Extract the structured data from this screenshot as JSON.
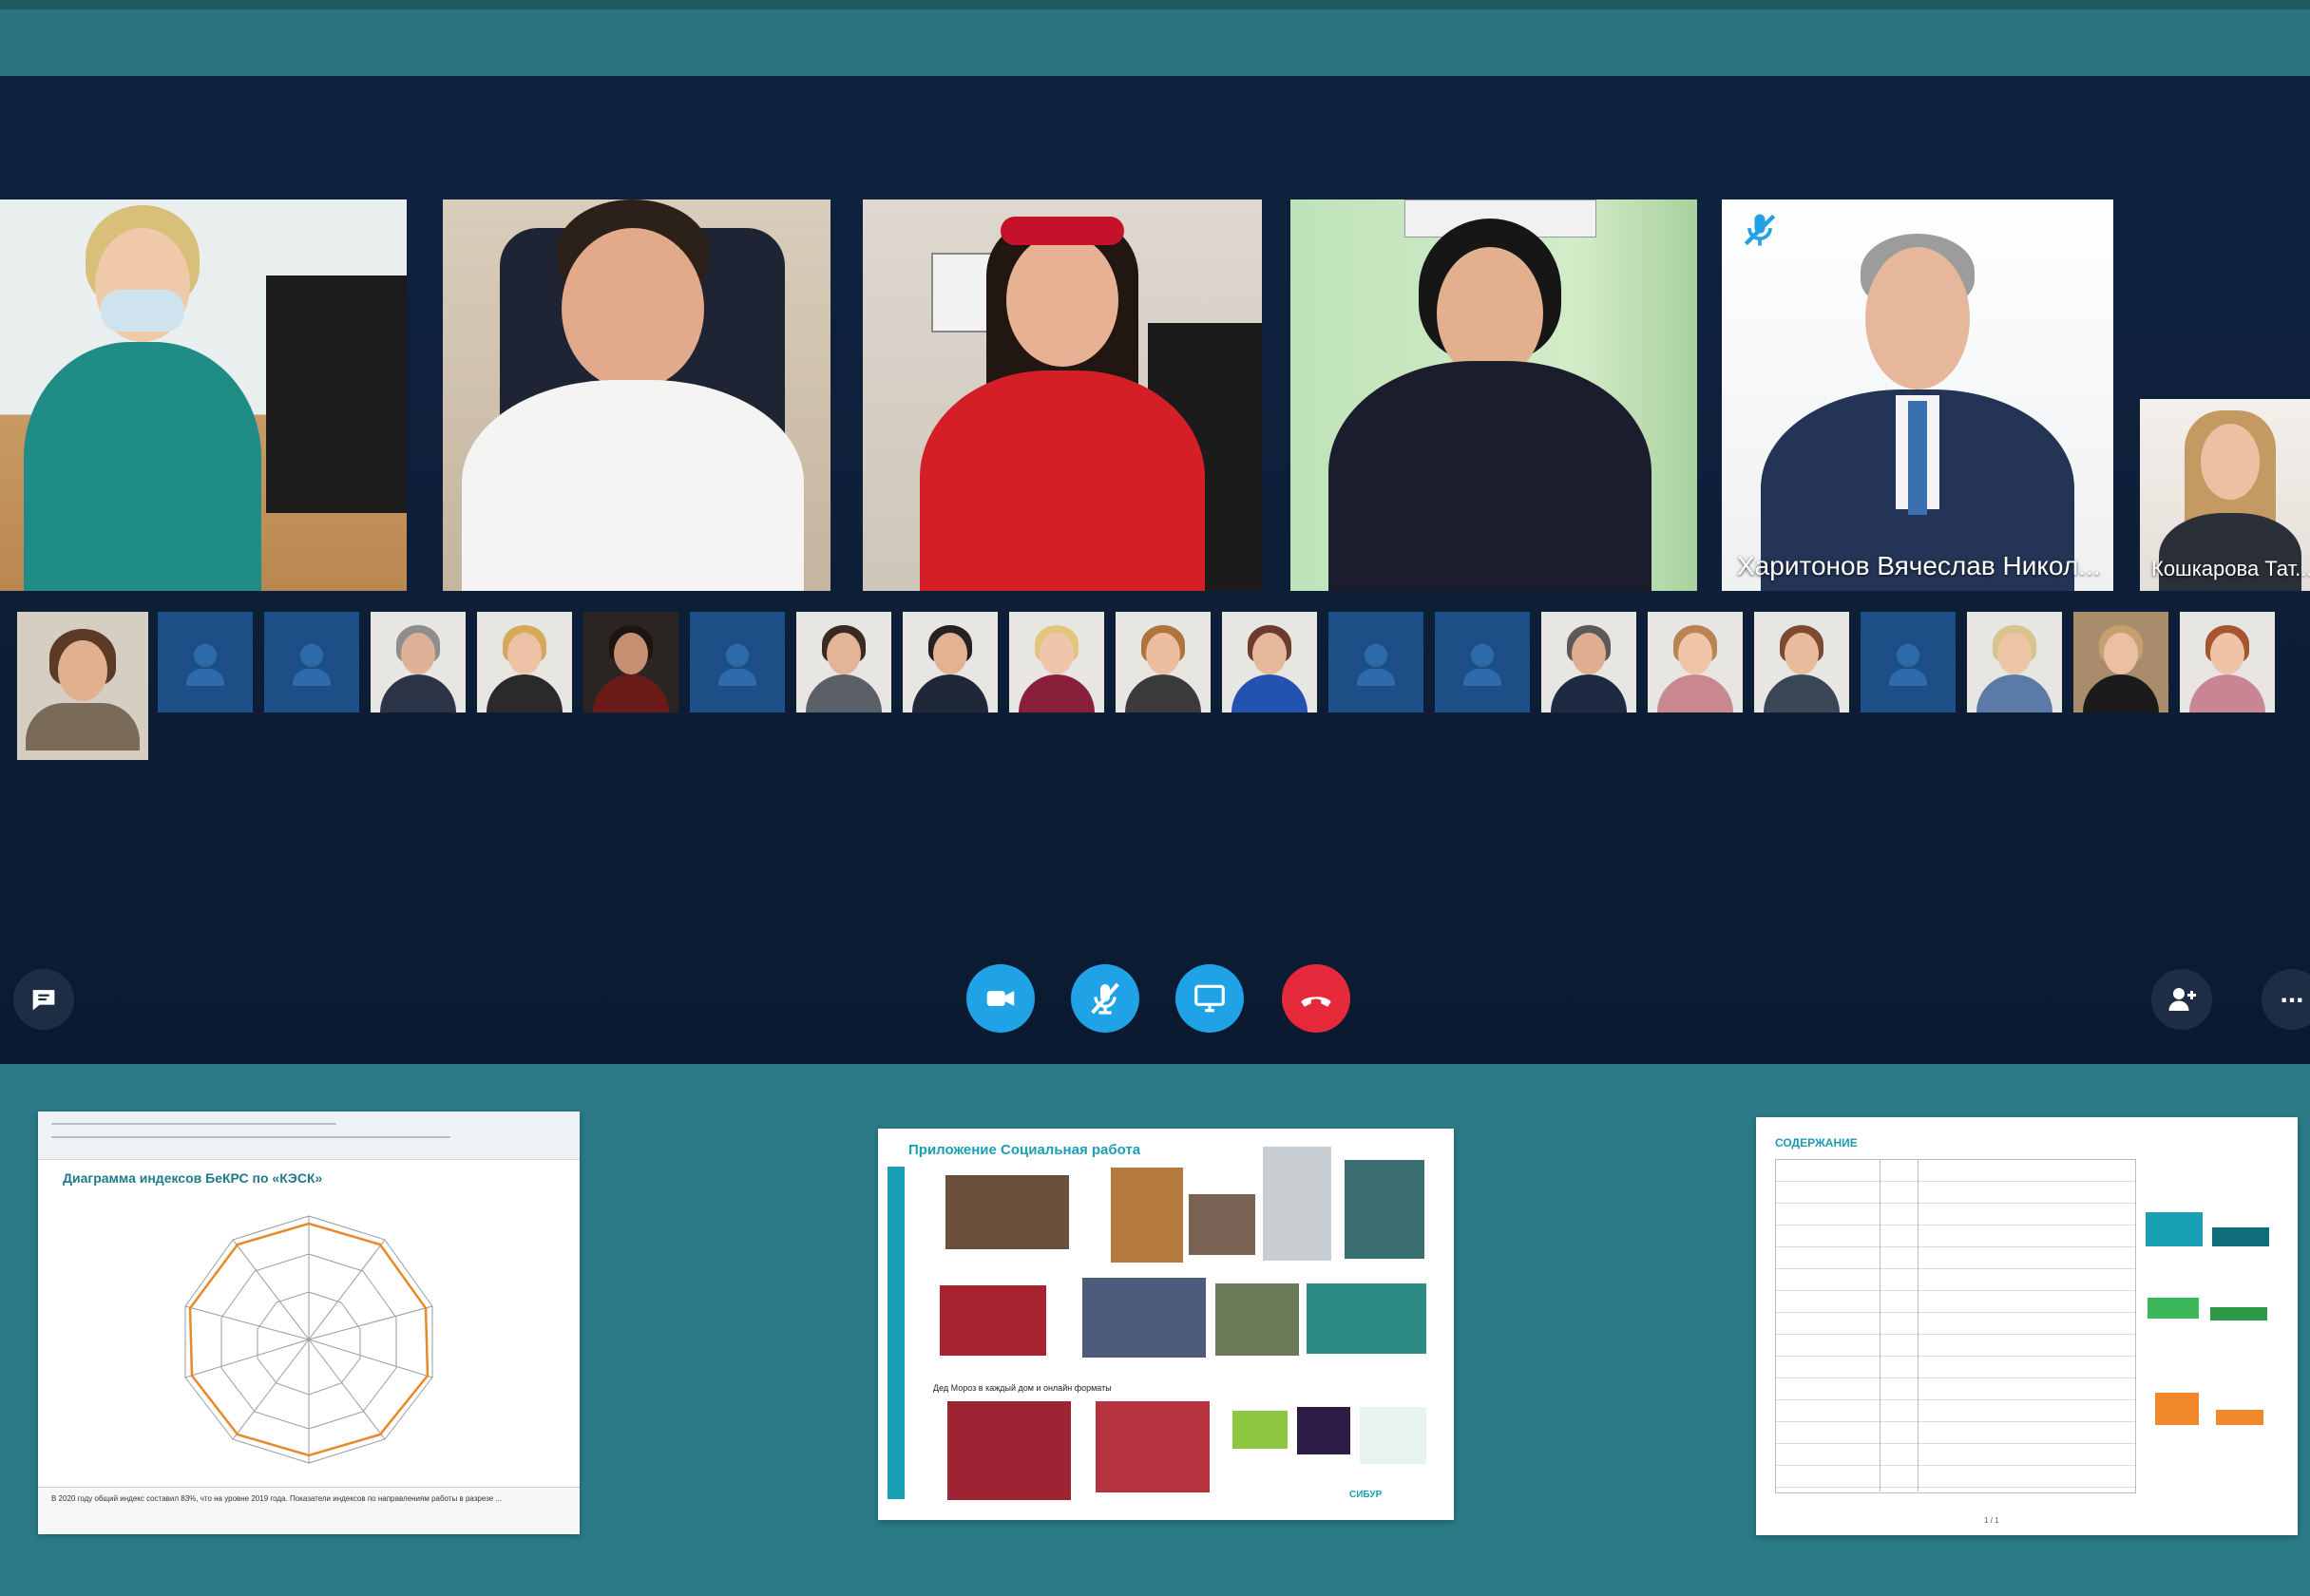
{
  "participants": {
    "main": [
      {
        "name": ""
      },
      {
        "name": ""
      },
      {
        "name": ""
      },
      {
        "name": ""
      },
      {
        "name": "Харитонов Вячеслав Никол...",
        "muted": true
      },
      {
        "name": "Кошкарова Тат..."
      }
    ]
  },
  "controls": {
    "chat": "chat-icon",
    "camera": "video-camera-icon",
    "mic": "microphone-muted-icon",
    "share": "screen-share-icon",
    "hangup": "end-call-icon",
    "add_people": "add-person-icon",
    "more": "..."
  },
  "slides": {
    "left": {
      "title": "Диаграмма индексов БеКРС по «КЭСК»",
      "footer": "В 2020 году общий индекс составил 83%, что на уровне 2019 года. Показатели индексов по направлениям работы в разрезе ..."
    },
    "middle": {
      "title": "Приложение Социальная работа",
      "section": "Дед Мороз в каждый дом и онлайн форматы",
      "brand": "СИБУР"
    },
    "right": {
      "title": "СОДЕРЖАНИЕ",
      "pager": "1 / 1"
    }
  },
  "colors": {
    "call_background": "#0d1e35",
    "band": "#2b7a86",
    "button_blue": "#1fa3e6",
    "button_red": "#e5293b",
    "avatar_tile": "#1d4f86"
  }
}
